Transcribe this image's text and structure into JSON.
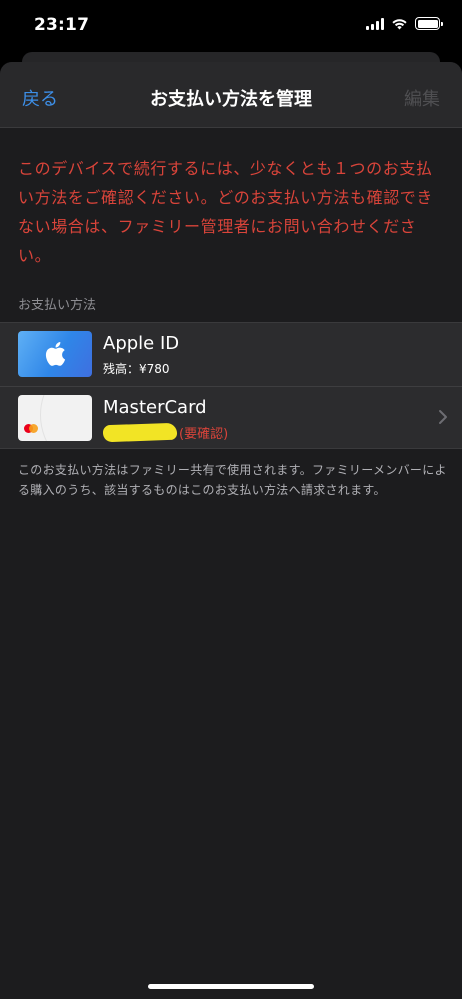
{
  "status_bar": {
    "time": "23:17",
    "icons": [
      "signal-icon",
      "wifi-icon",
      "battery-icon"
    ]
  },
  "nav": {
    "back_label": "戻る",
    "title": "お支払い方法を管理",
    "edit_label": "編集"
  },
  "warning_text": "このデバイスで続行するには、少なくとも１つのお支払い方法をご確認ください。どのお支払い方法も確認できない場合は、ファミリー管理者にお問い合わせください。",
  "section_header": "お支払い方法",
  "payment_methods": [
    {
      "name": "Apple ID",
      "detail": "残高：¥780",
      "icon": "apple-logo-icon"
    },
    {
      "name": "MasterCard",
      "detail": "(要確認)",
      "icon": "mastercard-logo-icon",
      "has_chevron": true
    }
  ],
  "footer_note": "このお支払い方法はファミリー共有で使用されます。ファミリーメンバーによる購入のうち、該当するものはこのお支払い方法へ請求されます。",
  "colors": {
    "accent_blue": "#3d8fe8",
    "warning_red": "#d9443a",
    "sheet_bg": "#1c1c1e",
    "row_bg": "#2c2c2e"
  }
}
